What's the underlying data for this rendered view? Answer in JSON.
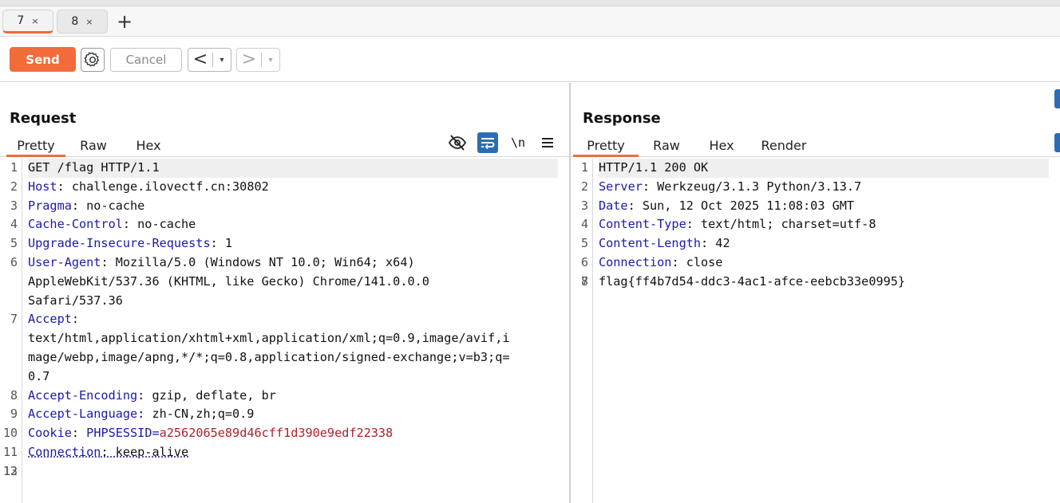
{
  "tabs": [
    {
      "label": "7",
      "close": "×"
    },
    {
      "label": "8",
      "close": "×"
    }
  ],
  "new_tab_label": "+",
  "toolbar": {
    "send_label": "Send",
    "cancel_label": "Cancel",
    "back_label": "<",
    "forward_label": ">",
    "dropdown_glyph": "▾"
  },
  "request": {
    "title": "Request",
    "tabs": [
      "Pretty",
      "Raw",
      "Hex"
    ],
    "newline_label": "\\n",
    "lines": [
      {
        "n": "1",
        "name": "",
        "value": "GET /flag HTTP/1.1"
      },
      {
        "n": "2",
        "name": "Host",
        "value": ": challenge.ilovectf.cn:30802"
      },
      {
        "n": "3",
        "name": "Pragma",
        "value": ": no-cache"
      },
      {
        "n": "4",
        "name": "Cache-Control",
        "value": ": no-cache"
      },
      {
        "n": "5",
        "name": "Upgrade-Insecure-Requests",
        "value": ": 1"
      },
      {
        "n": "6",
        "name": "User-Agent",
        "value": ": Mozilla/5.0 (Windows NT 10.0; Win64; x64)"
      },
      {
        "n": "",
        "name": "",
        "value": "AppleWebKit/537.36 (KHTML, like Gecko) Chrome/141.0.0.0"
      },
      {
        "n": "",
        "name": "",
        "value": "Safari/537.36"
      },
      {
        "n": "7",
        "name": "Accept",
        "value": ":"
      },
      {
        "n": "",
        "name": "",
        "value": "text/html,application/xhtml+xml,application/xml;q=0.9,image/avif,i"
      },
      {
        "n": "",
        "name": "",
        "value": "mage/webp,image/apng,*/*;q=0.8,application/signed-exchange;v=b3;q="
      },
      {
        "n": "",
        "name": "",
        "value": "0.7"
      },
      {
        "n": "8",
        "name": "Accept-Encoding",
        "value": ": gzip, deflate, br"
      },
      {
        "n": "9",
        "name": "Accept-Language",
        "value": ": zh-CN,zh;q=0.9"
      },
      {
        "n": "10",
        "name": "Cookie",
        "value": ": ",
        "cookie_name": "PHPSESSID",
        "cookie_eq": "=",
        "cookie_value": "a2562065e89d46cff1d390e9edf22338"
      },
      {
        "n": "11",
        "name": "Connection",
        "value": ": keep-alive"
      },
      {
        "n": "12",
        "name": "",
        "value": ""
      },
      {
        "n": "13",
        "name": "",
        "value": ""
      }
    ]
  },
  "response": {
    "title": "Response",
    "tabs": [
      "Pretty",
      "Raw",
      "Hex",
      "Render"
    ],
    "lines": [
      {
        "n": "1",
        "name": "",
        "value": "HTTP/1.1 200 OK"
      },
      {
        "n": "2",
        "name": "Server",
        "value": ": Werkzeug/3.1.3 Python/3.13.7"
      },
      {
        "n": "3",
        "name": "Date",
        "value": ": Sun, 12 Oct 2025 11:08:03 GMT"
      },
      {
        "n": "4",
        "name": "Content-Type",
        "value": ": text/html; charset=utf-8"
      },
      {
        "n": "5",
        "name": "Content-Length",
        "value": ": 42"
      },
      {
        "n": "6",
        "name": "Connection",
        "value": ": close"
      },
      {
        "n": "7",
        "name": "",
        "value": ""
      },
      {
        "n": "8",
        "name": "",
        "value": "flag{ff4b7d54-ddc3-4ac1-afce-eebcb33e0995}"
      }
    ]
  },
  "colors": {
    "accent": "#f26b3a",
    "header_name": "#1a1aa8",
    "cookie_value": "#b0202b",
    "icon_blue": "#2d6cb5"
  }
}
